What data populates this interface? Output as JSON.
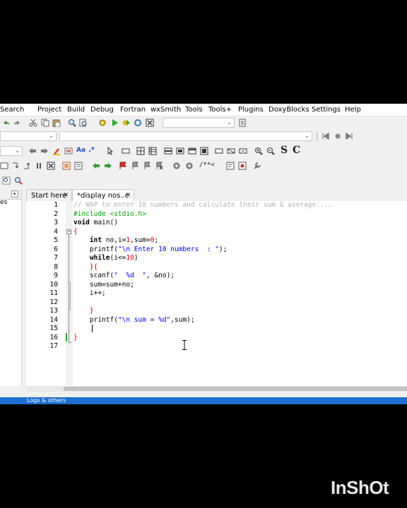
{
  "menu": [
    "Search",
    "Project",
    "Build",
    "Debug",
    "Fortran",
    "wxSmith",
    "Tools",
    "Tools+",
    "Plugins",
    "DoxyBlocks",
    "Settings",
    "Help"
  ],
  "toolbar": {
    "icons": [
      "undo-icon",
      "redo-icon",
      "cut-icon",
      "copy-icon",
      "paste-icon",
      "find-icon",
      "replace-icon",
      "settings-icon",
      "run-icon",
      "build-run-icon",
      "rebuild-icon",
      "abort-icon",
      "clipboard-icon"
    ],
    "bookmarks_icons": [
      "prev-bookmark-icon",
      "record-icon",
      "next-bookmark-icon"
    ],
    "text_tools": [
      "back-arrow-icon",
      "forward-arrow-icon",
      "highlight-icon",
      "match-case-label",
      "regex-label"
    ],
    "match_case_label": "Aa",
    "regex_label": ".*",
    "zoom_s": "S",
    "zoom_c": "C",
    "comment_label": "/**<"
  },
  "tabs": [
    {
      "label": "Start here",
      "close": "✕"
    },
    {
      "label": "*display nos..c",
      "close": "✕"
    }
  ],
  "left_panel_label": "es",
  "editor": {
    "line_numbers": [
      "1",
      "2",
      "3",
      "4",
      "5",
      "6",
      "7",
      "8",
      "9",
      "10",
      "11",
      "12",
      "13",
      "14",
      "15",
      "16",
      "17"
    ],
    "lines": [
      "// WAP to enter 10 numbers and calculate their sum & average....",
      "#include <stdio.h>",
      "void main()",
      "{",
      "    int no,i=1,sum=0;",
      "    printf(\"\\n Enter 10 numbers  : \");",
      "    while(i<=10)",
      "    {",
      "    scanf(\"  %d  \", &no);",
      "    sum=sum+no;",
      "    i++;",
      "",
      "    }",
      "    printf(\"\\n sum = %d\",sum);",
      "",
      "}",
      ""
    ]
  },
  "statusbar": {
    "label": "Logs & others"
  },
  "watermark": "InShOt",
  "colors": {
    "comment": "#b0b0b0",
    "preprocessor": "#00a000",
    "string": "#0000ff",
    "number": "#f00000",
    "statusbar": "#1e6fd0"
  }
}
